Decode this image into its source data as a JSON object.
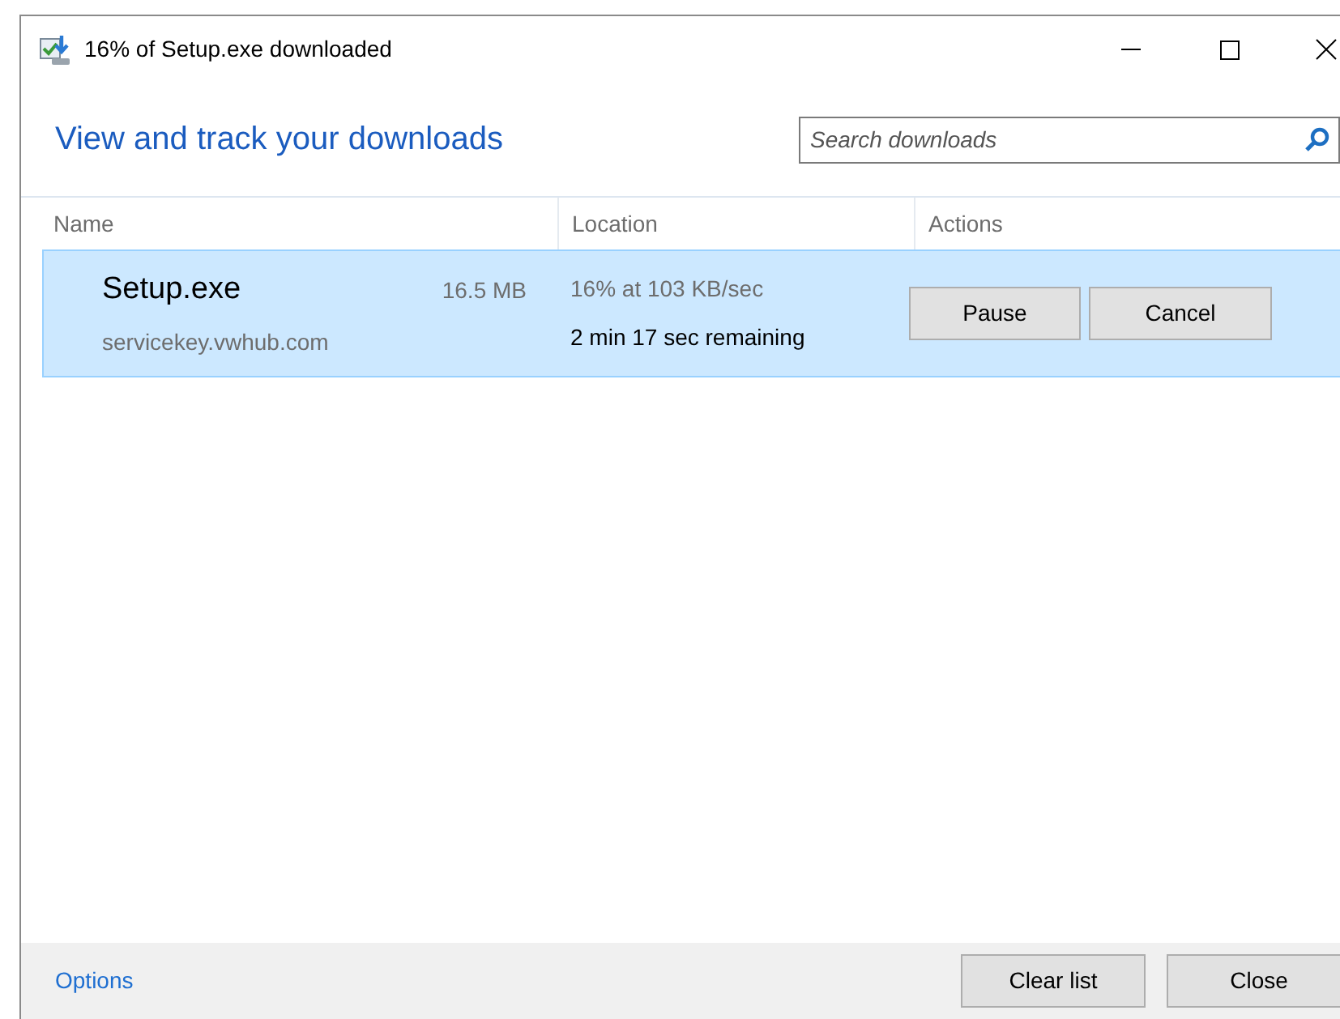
{
  "window": {
    "title": "16% of Setup.exe downloaded"
  },
  "heading": "View and track your downloads",
  "search": {
    "placeholder": "Search downloads"
  },
  "columns": [
    "Name",
    "Location",
    "Actions"
  ],
  "downloads": [
    {
      "name": "Setup.exe",
      "size": "16.5 MB",
      "source": "servicekey.vwhub.com",
      "progress": "16% at 103 KB/sec",
      "remaining": "2 min 17 sec remaining",
      "selected": true,
      "actions": [
        "Pause",
        "Cancel"
      ]
    }
  ],
  "footer": {
    "link": "Options",
    "buttons": [
      "Clear list",
      "Close"
    ]
  }
}
